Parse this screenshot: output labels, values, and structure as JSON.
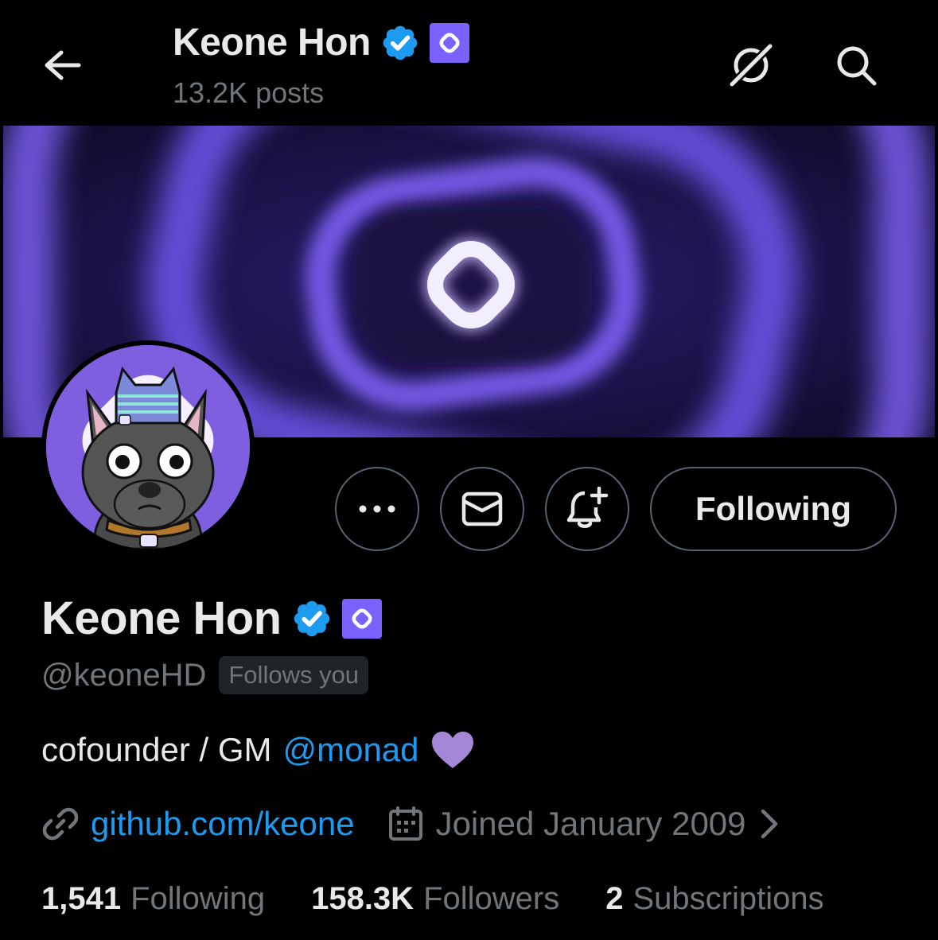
{
  "header": {
    "name": "Keone Hon",
    "posts": "13.2K posts"
  },
  "profile": {
    "name": "Keone Hon",
    "handle": "@keoneHD",
    "follows_you": "Follows you",
    "bio_text": "cofounder / GM",
    "bio_mention": "@monad",
    "website": "github.com/keone",
    "joined": "Joined January 2009"
  },
  "actions": {
    "following_label": "Following"
  },
  "stats": [
    {
      "value": "1,541",
      "label": "Following"
    },
    {
      "value": "158.3K",
      "label": "Followers"
    },
    {
      "value": "2",
      "label": "Subscriptions"
    }
  ],
  "icons": {
    "back": "arrow-left-icon",
    "grok": "grok-icon",
    "search": "search-icon",
    "verified": "verified-badge-icon",
    "affiliation": "monad-affiliation-icon",
    "more": "more-dots-icon",
    "message": "envelope-icon",
    "notify": "bell-plus-icon",
    "link": "link-icon",
    "calendar": "calendar-icon",
    "chevron": "chevron-right-icon",
    "heart": "purple-heart-icon"
  },
  "colors": {
    "background": "#000000",
    "text": "#e7e9ea",
    "muted": "#71767b",
    "link": "#1d9bf0",
    "verified": "#1d9bf0",
    "affiliation": "#7b62ff",
    "border": "#536471"
  }
}
